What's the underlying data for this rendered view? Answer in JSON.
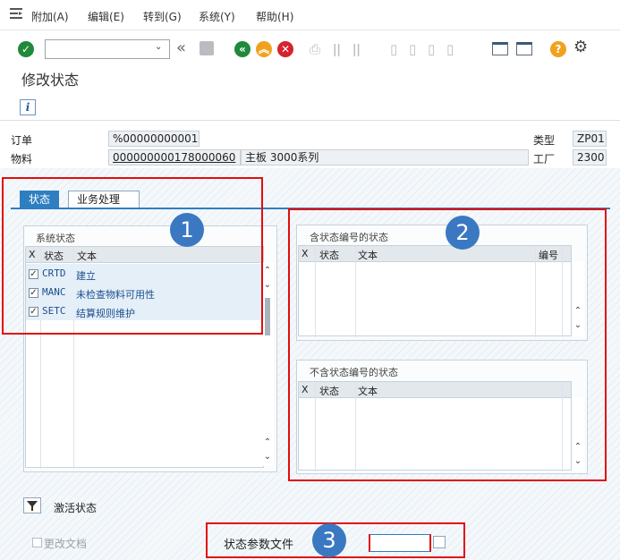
{
  "menubar": {
    "icon": "menu-list-icon",
    "items": [
      "附加(A)",
      "编辑(E)",
      "转到(G)",
      "系统(Y)",
      "帮助(H)"
    ]
  },
  "toolbar": {
    "command_value": "",
    "icons": [
      "enter-checkmark-icon",
      "dropdown-icon",
      "double-chevron-left-icon",
      "save-icon",
      "back-icon",
      "exit-icon",
      "cancel-icon",
      "print-icon",
      "find-icon",
      "find-next-icon",
      "first-page-icon",
      "prev-page-icon",
      "next-page-icon",
      "last-page-icon",
      "new-session-icon",
      "shortcut-icon",
      "help-icon",
      "settings-icon"
    ]
  },
  "page": {
    "title": "修改状态"
  },
  "header": {
    "order_label": "订单",
    "order_value": "%00000000001",
    "material_label": "物料",
    "material_value": "000000000178000060",
    "material_desc": "主板 3000系列",
    "type_label": "类型",
    "type_value": "ZP01",
    "plant_label": "工厂",
    "plant_value": "2300"
  },
  "tabs": [
    {
      "label": "状态",
      "active": true
    },
    {
      "label": "业务处理",
      "active": false
    }
  ],
  "system_status": {
    "title": "系统状态",
    "columns": [
      "X",
      "状态",
      "文本"
    ],
    "rows": [
      {
        "checked": true,
        "status": "CRTD",
        "text": "建立"
      },
      {
        "checked": true,
        "status": "MANC",
        "text": "未检查物料可用性"
      },
      {
        "checked": true,
        "status": "SETC",
        "text": "结算规则维护"
      }
    ]
  },
  "user_status_numbered": {
    "title": "含状态编号的状态",
    "columns": [
      "X",
      "状态",
      "文本",
      "编号"
    ]
  },
  "user_status_unnumbered": {
    "title": "不含状态编号的状态",
    "columns": [
      "X",
      "状态",
      "文本"
    ]
  },
  "activate_label": "激活状态",
  "change_docs_label": "更改文档",
  "status_profile_label": "状态参数文件",
  "status_profile_value": "",
  "callouts": [
    "1",
    "2",
    "3"
  ],
  "colors": {
    "accent": "#2f7ec0",
    "annotation_red": "#e30c0c",
    "badge_blue": "#3b78c2"
  }
}
